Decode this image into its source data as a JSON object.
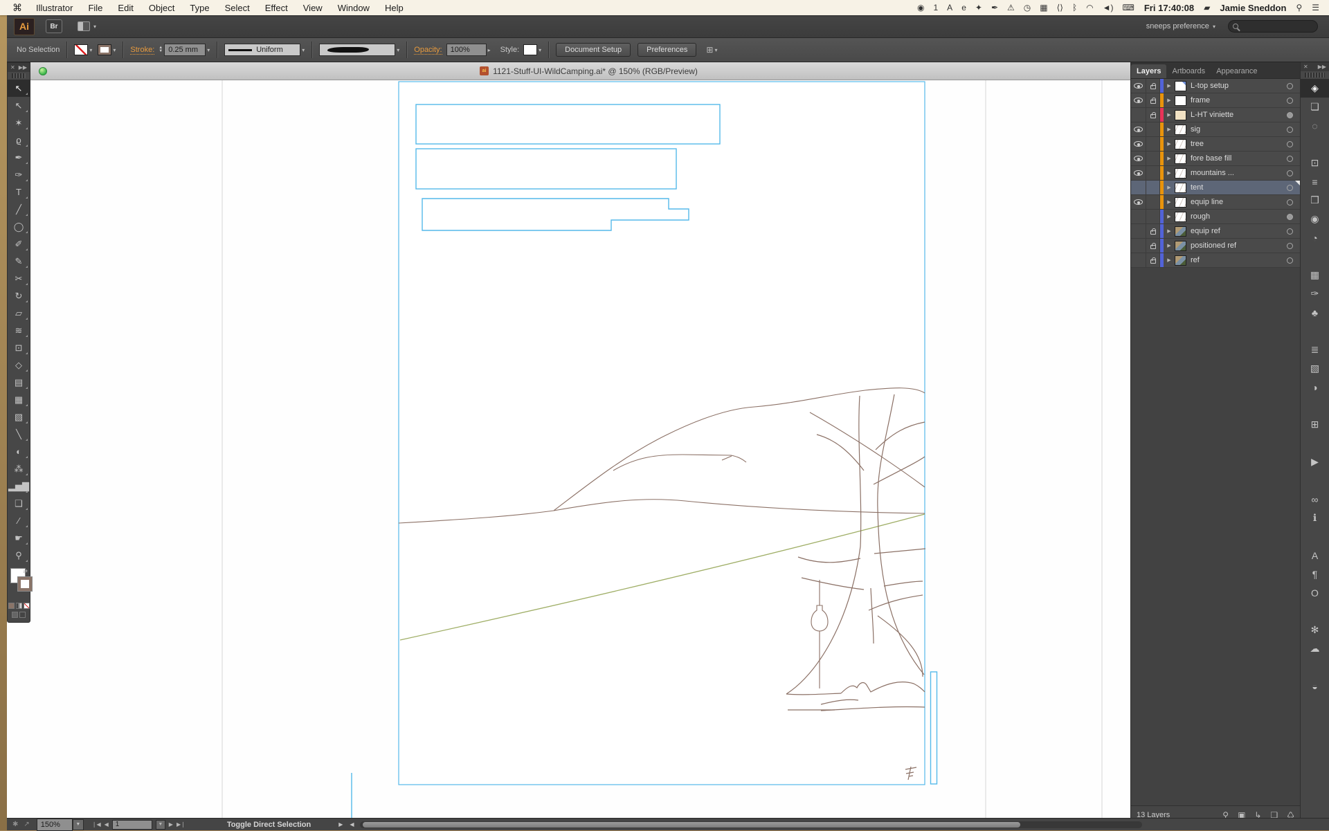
{
  "menu_bar": {
    "apple_glyph": "⌘",
    "items": [
      "Illustrator",
      "File",
      "Edit",
      "Object",
      "Type",
      "Select",
      "Effect",
      "View",
      "Window",
      "Help"
    ],
    "status_icons": [
      {
        "name": "creative-cloud-icon",
        "glyph": "◉"
      },
      {
        "name": "cc-sync-count",
        "glyph": "1"
      },
      {
        "name": "adobe-icon",
        "glyph": "A"
      },
      {
        "name": "evernote-icon",
        "glyph": "e"
      },
      {
        "name": "dropbox-icon",
        "glyph": "✦"
      },
      {
        "name": "pen-icon",
        "glyph": "✒"
      },
      {
        "name": "warning-icon",
        "glyph": "⚠"
      },
      {
        "name": "time-machine-icon",
        "glyph": "◷"
      },
      {
        "name": "keyboard-icon",
        "glyph": "▦"
      },
      {
        "name": "code-brackets-icon",
        "glyph": "⟨⟩"
      },
      {
        "name": "bluetooth-icon",
        "glyph": "ᛒ"
      },
      {
        "name": "wifi-icon",
        "glyph": "◠"
      },
      {
        "name": "volume-icon",
        "glyph": "◄)"
      },
      {
        "name": "keyboard-viewer-icon",
        "glyph": "⌨"
      }
    ],
    "clock": "Fri 17:40:08",
    "battery_glyph": "▰",
    "user": "Jamie Sneddon",
    "spotlight_glyph": "⚲",
    "notification_glyph": "☰"
  },
  "app_bar": {
    "ai_logo": "Ai",
    "bridge_label": "Br",
    "workspace": "sneeps preference",
    "workspace_arrow": "▾"
  },
  "control_bar": {
    "selection_status": "No Selection",
    "stroke_label": "Stroke:",
    "stroke_value": "0.25 mm",
    "width_profile": "Uniform",
    "opacity_label": "Opacity:",
    "opacity_value": "100%",
    "style_label": "Style:",
    "document_setup_label": "Document Setup",
    "preferences_label": "Preferences"
  },
  "document": {
    "title": "1121-Stuff-UI-WildCamping.ai* @ 150% (RGB/Preview)",
    "icon_text": "ai"
  },
  "toolbar": {
    "tools": [
      {
        "name": "selection-tool",
        "glyph": "↖",
        "active": true
      },
      {
        "name": "direct-selection-tool",
        "glyph": "↖"
      },
      {
        "name": "magic-wand-tool",
        "glyph": "✶"
      },
      {
        "name": "lasso-tool",
        "glyph": "ϱ"
      },
      {
        "name": "pen-tool",
        "glyph": "✒"
      },
      {
        "name": "blob-brush-tool",
        "glyph": "✑"
      },
      {
        "name": "type-tool",
        "glyph": "T"
      },
      {
        "name": "line-segment-tool",
        "glyph": "╱"
      },
      {
        "name": "ellipse-tool",
        "glyph": "◯"
      },
      {
        "name": "paintbrush-tool",
        "glyph": "✐"
      },
      {
        "name": "pencil-tool",
        "glyph": "✎"
      },
      {
        "name": "scissors-tool",
        "glyph": "✂"
      },
      {
        "name": "rotate-tool",
        "glyph": "↻"
      },
      {
        "name": "scale-tool",
        "glyph": "▱"
      },
      {
        "name": "width-tool",
        "glyph": "≋"
      },
      {
        "name": "free-transform-tool",
        "glyph": "⊡"
      },
      {
        "name": "shape-builder-tool",
        "glyph": "◇"
      },
      {
        "name": "perspective-grid-tool",
        "glyph": "▤"
      },
      {
        "name": "mesh-tool",
        "glyph": "▦"
      },
      {
        "name": "gradient-tool",
        "glyph": "▧"
      },
      {
        "name": "eyedropper-tool",
        "glyph": "╲"
      },
      {
        "name": "blend-tool",
        "glyph": "◐"
      },
      {
        "name": "symbol-sprayer-tool",
        "glyph": "⁂"
      },
      {
        "name": "column-graph-tool",
        "glyph": "▂▅▇"
      },
      {
        "name": "artboard-tool",
        "glyph": "❑"
      },
      {
        "name": "slice-tool",
        "glyph": "∕"
      },
      {
        "name": "hand-tool",
        "glyph": "☛"
      },
      {
        "name": "zoom-tool",
        "glyph": "⚲"
      }
    ]
  },
  "layers_panel": {
    "tabs": [
      {
        "label": "Layers",
        "active": true
      },
      {
        "label": "Artboards",
        "active": false
      },
      {
        "label": "Appearance",
        "active": false
      }
    ],
    "tab_overflow_glyph": "▶▶",
    "panel_menu_glyph": "▾≡",
    "rows": [
      {
        "name": "L-top setup",
        "eye": true,
        "lock": true,
        "color": "#5263d8",
        "thumb": "page",
        "filled_target": false,
        "selected": false
      },
      {
        "name": "frame",
        "eye": true,
        "lock": true,
        "color": "#e8930c",
        "thumb": "blank",
        "filled_target": false,
        "selected": false
      },
      {
        "name": "L-HT viniette",
        "eye": false,
        "lock": true,
        "color": "#e83358",
        "thumb": "cream",
        "filled_target": true,
        "selected": false
      },
      {
        "name": "sig",
        "eye": true,
        "lock": false,
        "color": "#e8930c",
        "thumb": "sketch",
        "filled_target": false,
        "selected": false
      },
      {
        "name": "tree",
        "eye": true,
        "lock": false,
        "color": "#e8930c",
        "thumb": "sketch",
        "filled_target": false,
        "selected": false
      },
      {
        "name": "fore base fill",
        "eye": true,
        "lock": false,
        "color": "#e8930c",
        "thumb": "sketch",
        "filled_target": false,
        "selected": false
      },
      {
        "name": "mountains ...",
        "eye": true,
        "lock": false,
        "color": "#e8930c",
        "thumb": "sketch",
        "filled_target": false,
        "selected": false
      },
      {
        "name": "tent",
        "eye": false,
        "lock": false,
        "color": "#e8930c",
        "thumb": "sketch",
        "filled_target": false,
        "selected": true
      },
      {
        "name": "equip line",
        "eye": true,
        "lock": false,
        "color": "#e8930c",
        "thumb": "sketch",
        "filled_target": false,
        "selected": false
      },
      {
        "name": "rough",
        "eye": false,
        "lock": false,
        "color": "#5263d8",
        "thumb": "sketch",
        "filled_target": true,
        "selected": false
      },
      {
        "name": "equip ref",
        "eye": false,
        "lock": true,
        "color": "#5263d8",
        "thumb": "photo",
        "filled_target": false,
        "selected": false
      },
      {
        "name": "positioned ref",
        "eye": false,
        "lock": true,
        "color": "#5263d8",
        "thumb": "photo",
        "filled_target": false,
        "selected": false
      },
      {
        "name": "ref",
        "eye": false,
        "lock": true,
        "color": "#5263d8",
        "thumb": "photo",
        "filled_target": false,
        "selected": false
      }
    ],
    "count_label": "13 Layers",
    "bottom_icons": [
      {
        "name": "locate-object-icon",
        "glyph": "⚲"
      },
      {
        "name": "make-clipping-mask-icon",
        "glyph": "▣"
      },
      {
        "name": "new-sublayer-icon",
        "glyph": "↳"
      },
      {
        "name": "new-layer-icon",
        "glyph": "❏"
      },
      {
        "name": "delete-layer-icon",
        "glyph": "♺"
      }
    ]
  },
  "dock": {
    "close_glyph": "✕",
    "expand_glyph": "▶▶",
    "icons": [
      {
        "name": "layers-panel-icon",
        "glyph": "◈",
        "active": true
      },
      {
        "name": "artboards-panel-icon",
        "glyph": "❏"
      },
      {
        "name": "selection-panel-icon",
        "glyph": "◌"
      },
      {
        "name": "divider",
        "glyph": "",
        "divider": true
      },
      {
        "name": "transform-panel-icon",
        "glyph": "⊡"
      },
      {
        "name": "align-panel-icon",
        "glyph": "≡"
      },
      {
        "name": "pathfinder-panel-icon",
        "glyph": "❒"
      },
      {
        "name": "color-panel-icon",
        "glyph": "◉"
      },
      {
        "name": "gradient-fan-panel-icon",
        "glyph": "◔"
      },
      {
        "name": "divider",
        "glyph": "",
        "divider": true
      },
      {
        "name": "swatches-panel-icon",
        "glyph": "▦"
      },
      {
        "name": "brushes-panel-icon",
        "glyph": "✑"
      },
      {
        "name": "symbols-panel-icon",
        "glyph": "♣"
      },
      {
        "name": "divider",
        "glyph": "",
        "divider": true
      },
      {
        "name": "stroke-panel-icon",
        "glyph": "≣"
      },
      {
        "name": "gradient-panel-icon",
        "glyph": "▧"
      },
      {
        "name": "transparency-panel-icon",
        "glyph": "◑"
      },
      {
        "name": "divider",
        "glyph": "",
        "divider": true
      },
      {
        "name": "symbol-options-panel-icon",
        "glyph": "⊞"
      },
      {
        "name": "divider",
        "glyph": "",
        "divider": true
      },
      {
        "name": "actions-panel-icon",
        "glyph": "▶"
      },
      {
        "name": "divider",
        "glyph": "",
        "divider": true
      },
      {
        "name": "links-panel-icon",
        "glyph": "∞"
      },
      {
        "name": "document-info-panel-icon",
        "glyph": "ℹ"
      },
      {
        "name": "divider",
        "glyph": "",
        "divider": true
      },
      {
        "name": "character-panel-icon",
        "glyph": "A"
      },
      {
        "name": "paragraph-panel-icon",
        "glyph": "¶"
      },
      {
        "name": "opentype-panel-icon",
        "glyph": "O"
      },
      {
        "name": "divider",
        "glyph": "",
        "divider": true
      },
      {
        "name": "settings-panel-icon",
        "glyph": "✻"
      },
      {
        "name": "creative-cloud-panel-icon",
        "glyph": "☁"
      },
      {
        "name": "divider",
        "glyph": "",
        "divider": true
      },
      {
        "name": "color-guide-panel-icon",
        "glyph": "◒"
      }
    ]
  },
  "status_bar": {
    "sync_glyph": "✱",
    "export_glyph": "↗",
    "zoom_value": "150%",
    "nav_first": "❘◀",
    "nav_prev": "◀",
    "artboard_number": "1",
    "nav_next": "▶",
    "nav_last": "▶❘",
    "status_text": "Toggle Direct Selection",
    "arrow_right": "▶",
    "arrow_left": "◀"
  },
  "artboard": {
    "colors": {
      "line": "#8b7065",
      "green": "#9fae66",
      "cyan": "#54b9ea",
      "guide": "#d6d6d6"
    }
  }
}
